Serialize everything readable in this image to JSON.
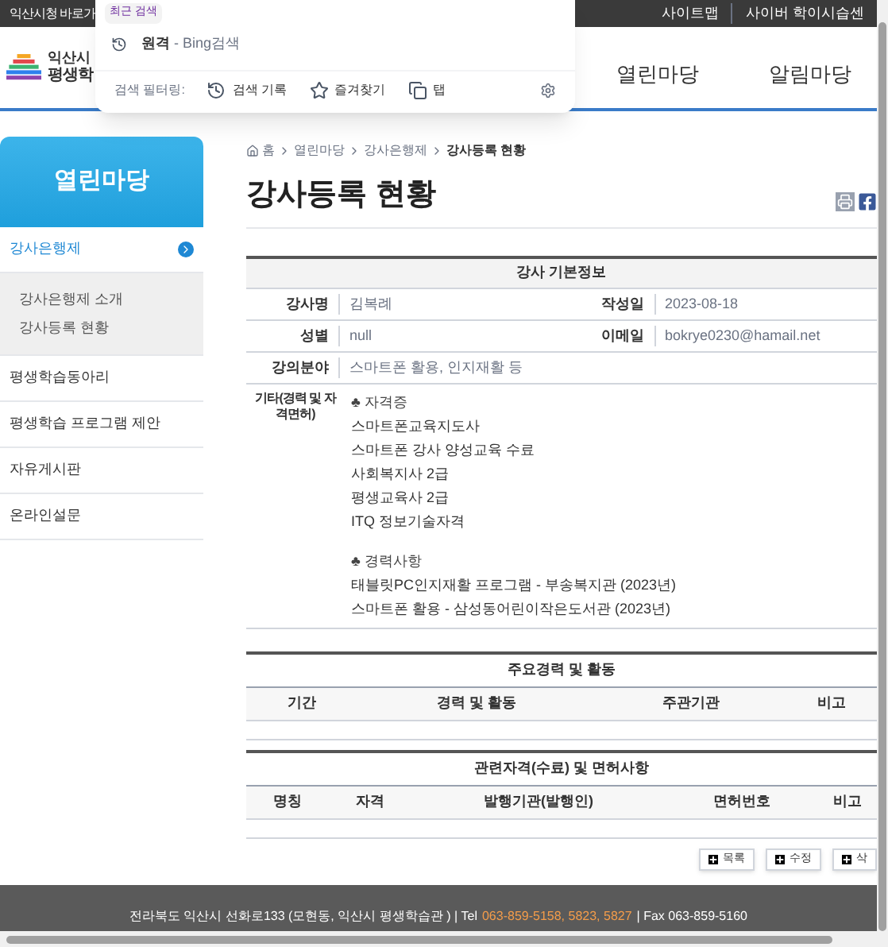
{
  "top_bar": {
    "left_link": "익산시청 바로가",
    "right_links": [
      "사이트맵",
      "사이버 학이시습센"
    ]
  },
  "header": {
    "logo_lines": [
      "익산시",
      "평생학"
    ],
    "nav": [
      "열린마당",
      "알림마당"
    ]
  },
  "search_dropdown": {
    "section_label": "최근 검색",
    "history": [
      {
        "query": "원격",
        "source": "- Bing검색"
      }
    ],
    "filter_label": "검색 필터링:",
    "filters": [
      {
        "kind": "history",
        "label": "검색 기록"
      },
      {
        "kind": "favorites",
        "label": "즐겨찾기"
      },
      {
        "kind": "tabs",
        "label": "탭"
      }
    ]
  },
  "sidebar": {
    "title": "열린마당",
    "items": [
      {
        "label": "강사은행제",
        "selected": true,
        "children": [
          {
            "label": "강사은행제 소개"
          },
          {
            "label": "강사등록 현황"
          }
        ]
      },
      {
        "label": "평생학습동아리",
        "selected": false
      },
      {
        "label": "평생학습 프로그램 제안",
        "selected": false
      },
      {
        "label": "자유게시판",
        "selected": false
      },
      {
        "label": "온라인설문",
        "selected": false
      }
    ]
  },
  "breadcrumb": [
    "홈",
    "열린마당",
    "강사은행제",
    "강사등록 현황"
  ],
  "page_title": "강사등록 현황",
  "basic_info": {
    "title": "강사 기본정보",
    "rows": [
      [
        {
          "label": "강사명",
          "value": "김복례"
        },
        {
          "label": "작성일",
          "value": "2023-08-18"
        }
      ],
      [
        {
          "label": "성별",
          "value": "null"
        },
        {
          "label": "이메일",
          "value": "bokrye0230@hamail.net"
        }
      ],
      [
        {
          "label": "강의분야",
          "value": "스마트폰 활용, 인지재활 등"
        }
      ]
    ],
    "other": {
      "label": "기타(경력 및 자격면허)",
      "groups": [
        {
          "heading": "♣ 자격증",
          "lines": [
            "스마트폰교육지도사",
            "스마트폰 강사 양성교육 수료",
            "사회복지사 2급",
            "평생교육사 2급",
            "ITQ 정보기술자격"
          ]
        },
        {
          "heading": "♣ 경력사항",
          "lines": [
            "태블릿PC인지재활 프로그램 - 부송복지관 (2023년)",
            "스마트폰 활용 -  삼성동어린이작은도서관 (2023년)"
          ]
        }
      ]
    }
  },
  "careers": {
    "title": "주요경력 및 활동",
    "columns": [
      "기간",
      "경력 및 활동",
      "주관기관",
      "비고"
    ]
  },
  "licenses": {
    "title": "관련자격(수료) 및 면허사항",
    "columns": [
      "명칭",
      "자격",
      "발행기관(발행인)",
      "면허번호",
      "비고"
    ]
  },
  "buttons": [
    "목록",
    "수정",
    "삭"
  ],
  "footer": {
    "address": "전라북도 익산시 선화로133 (모현동, 익산시 평생학습관 ) | Tel",
    "phone": "063-859-5158, 5823, 5827",
    "fax": "| Fax 063-859-5160"
  }
}
